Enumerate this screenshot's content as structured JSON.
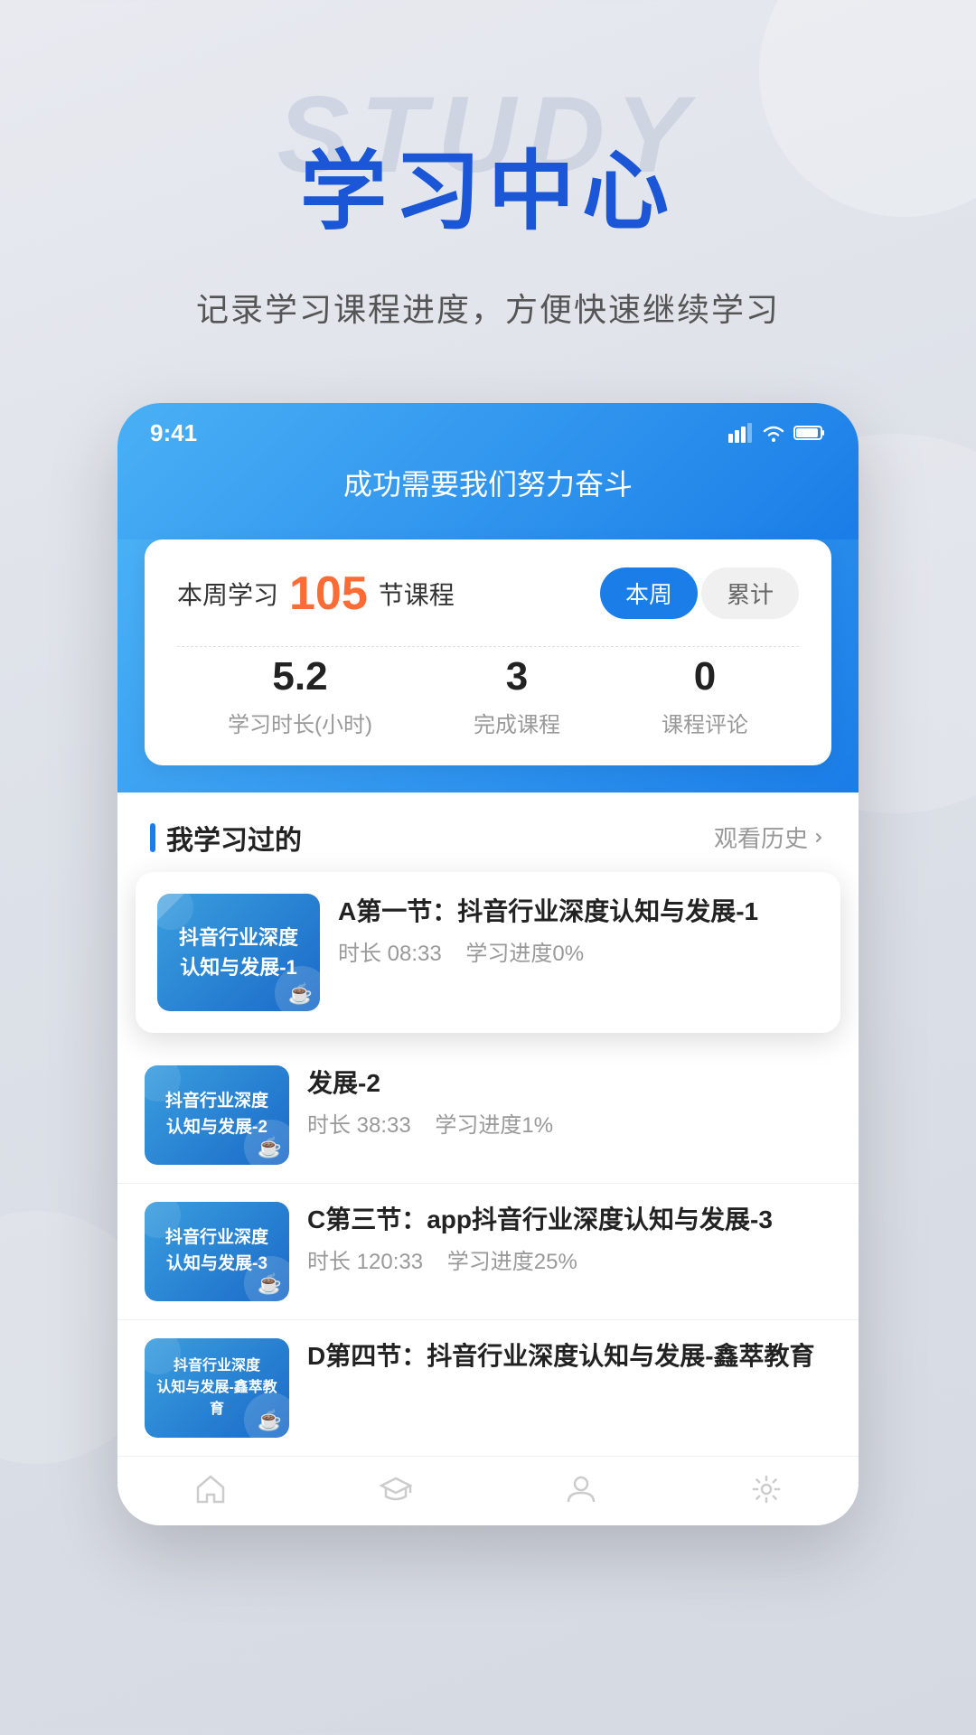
{
  "page": {
    "bg_study_text": "STUDY",
    "main_title": "学习中心",
    "subtitle": "记录学习课程进度，方便快速继续学习"
  },
  "phone": {
    "status_time": "9:41",
    "nav_title": "成功需要我们努力奋斗",
    "stats": {
      "prefix": "本周学习",
      "number": "105",
      "suffix": "节课程",
      "tab_week": "本周",
      "tab_total": "累计",
      "items": [
        {
          "value": "5.2",
          "label": "学习时长(小时)"
        },
        {
          "value": "3",
          "label": "完成课程"
        },
        {
          "value": "0",
          "label": "课程评论"
        }
      ]
    },
    "section": {
      "title": "我学习过的",
      "link": "观看历史"
    },
    "courses": [
      {
        "thumb_text": "抖音行业深度\n认知与发展-1",
        "title": "A第一节：抖音行业深度认知与发展-1",
        "duration": "时长 08:33",
        "progress": "学习进度0%",
        "featured": true
      },
      {
        "thumb_text": "抖音行业深度\n认知与发展-2",
        "title": "发展-2",
        "duration": "时长 38:33",
        "progress": "学习进度1%",
        "featured": false
      },
      {
        "thumb_text": "抖音行业深度\n认知与发展-3",
        "title": "C第三节：app抖音行业深度认知与发展-3",
        "duration": "时长 120:33",
        "progress": "学习进度25%",
        "featured": false
      },
      {
        "thumb_text": "抖音行业深度\n认知与发展-鑫萃教育",
        "title": "D第四节：抖音行业深度认知与发展-鑫萃教育",
        "duration": "",
        "progress": "",
        "featured": false
      }
    ],
    "bottom_nav": [
      {
        "icon": "home-icon",
        "label": ""
      },
      {
        "icon": "graduation-icon",
        "label": ""
      },
      {
        "icon": "person-icon",
        "label": ""
      },
      {
        "icon": "settings-icon",
        "label": ""
      }
    ]
  },
  "colors": {
    "accent_blue": "#1a7de8",
    "orange": "#ff6b35",
    "text_dark": "#222222",
    "text_gray": "#999999"
  }
}
